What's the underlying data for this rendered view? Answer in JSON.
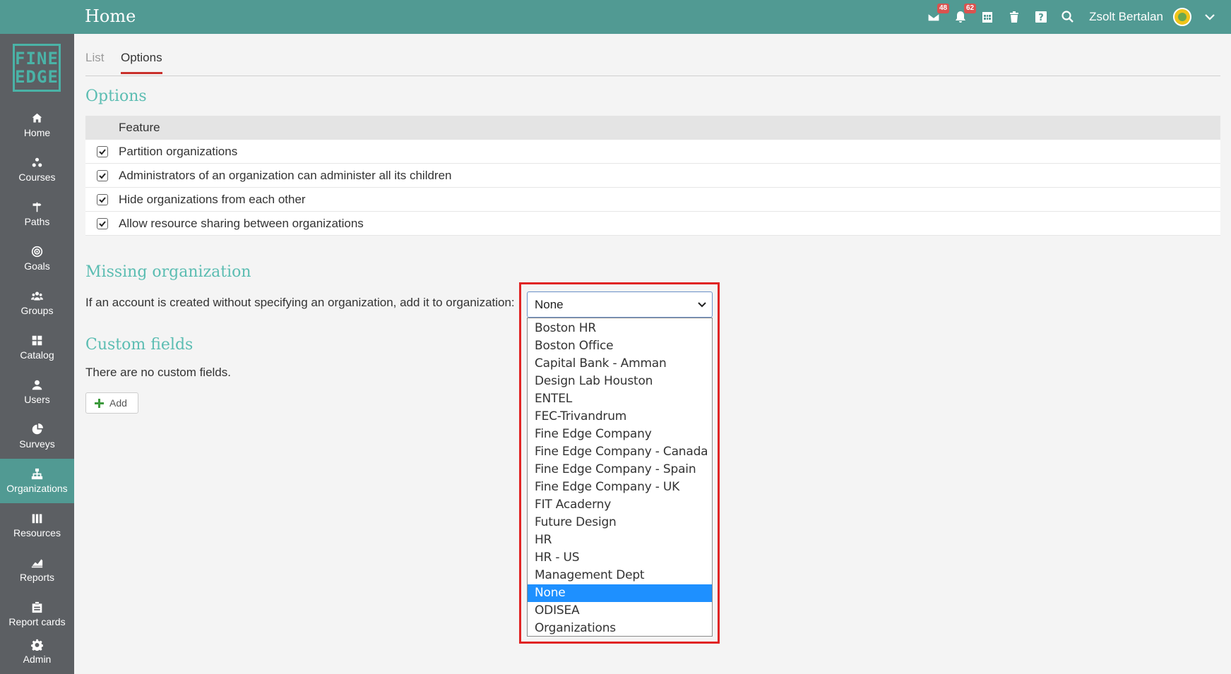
{
  "header": {
    "title": "Home",
    "messages_count": "48",
    "notifications_count": "62",
    "user_name": "Zsolt Bertalan"
  },
  "logo": {
    "line1": "FINE",
    "line2": "EDGE"
  },
  "sidebar": {
    "items": [
      {
        "label": "Home",
        "icon": "home-icon"
      },
      {
        "label": "Courses",
        "icon": "courses-icon"
      },
      {
        "label": "Paths",
        "icon": "paths-icon"
      },
      {
        "label": "Goals",
        "icon": "goals-icon"
      },
      {
        "label": "Groups",
        "icon": "groups-icon"
      },
      {
        "label": "Catalog",
        "icon": "catalog-icon"
      },
      {
        "label": "Users",
        "icon": "users-icon"
      },
      {
        "label": "Surveys",
        "icon": "surveys-icon"
      },
      {
        "label": "Organizations",
        "icon": "organizations-icon",
        "active": true
      },
      {
        "label": "Resources",
        "icon": "resources-icon"
      },
      {
        "label": "Reports",
        "icon": "reports-icon"
      },
      {
        "label": "Report cards",
        "icon": "report-cards-icon"
      },
      {
        "label": "Admin",
        "icon": "admin-icon"
      }
    ]
  },
  "tabs": {
    "list": "List",
    "options": "Options"
  },
  "options_section": {
    "title": "Options",
    "column_header": "Feature",
    "rows": [
      {
        "label": "Partition organizations",
        "checked": true
      },
      {
        "label": "Administrators of an organization can administer all its children",
        "checked": true
      },
      {
        "label": "Hide organizations from each other",
        "checked": true
      },
      {
        "label": "Allow resource sharing between organizations",
        "checked": true
      }
    ]
  },
  "missing_section": {
    "title": "Missing organization",
    "text": "If an account is created without specifying an organization, add it to organization:",
    "selected": "None",
    "options": [
      "Boston HR",
      "Boston Office",
      "Capital Bank - Amman",
      "Design Lab Houston",
      "ENTEL",
      "FEC-Trivandrum",
      "Fine Edge Company",
      "Fine Edge Company - Canada",
      "Fine Edge Company - Spain",
      "Fine Edge Company - UK",
      "FIT Acaderny",
      "Future Design",
      "HR",
      "HR - US",
      "Management Dept",
      "None",
      "ODISEA",
      "Organizations"
    ]
  },
  "custom_section": {
    "title": "Custom fields",
    "empty_text": "There are no custom fields.",
    "add_label": "Add"
  },
  "colors": {
    "accent": "#519a93",
    "heading": "#5bbdb2",
    "sidebar": "#5c5f63",
    "highlight": "#e02424",
    "selected": "#1e90ff"
  }
}
